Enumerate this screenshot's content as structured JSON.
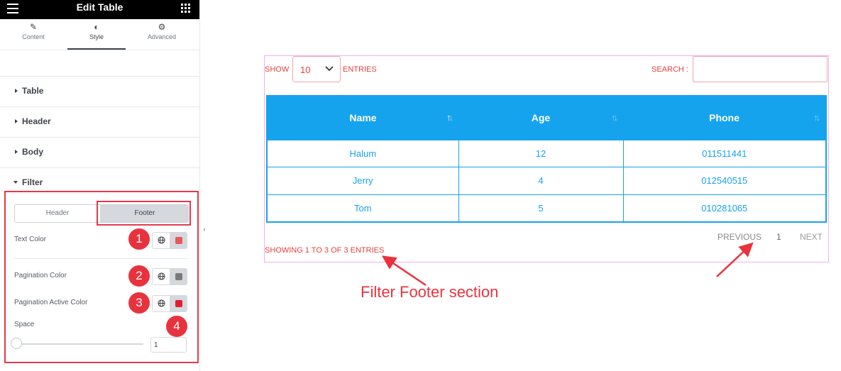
{
  "panel": {
    "title": "Edit Table",
    "tabs": [
      {
        "label": "Content",
        "icon": "pencil-icon"
      },
      {
        "label": "Style",
        "icon": "half-circle-icon"
      },
      {
        "label": "Advanced",
        "icon": "gear-icon"
      }
    ],
    "sections": [
      "Table",
      "Header",
      "Body",
      "Filter"
    ],
    "filter": {
      "segments": [
        "Header",
        "Footer"
      ],
      "active_segment": "Footer",
      "controls": [
        {
          "label": "Text Color",
          "color": "#e85a5a",
          "badge": "1"
        },
        {
          "label": "Pagination Color",
          "color": "#7a7a7a",
          "badge": "2"
        },
        {
          "label": "Pagination Active Color",
          "color": "#e01f2e",
          "badge": "3"
        }
      ],
      "space": {
        "label": "Space",
        "badge": "4",
        "value": "1"
      }
    }
  },
  "preview": {
    "show_label": "SHOW",
    "entries_value": "10",
    "entries_label": "ENTRIES",
    "search_label": "SEARCH :",
    "search_value": "",
    "columns": [
      "Name",
      "Age",
      "Phone"
    ],
    "rows": [
      [
        "Halum",
        "12",
        "011511441"
      ],
      [
        "Jerry",
        "4",
        "012540515"
      ],
      [
        "Tom",
        "5",
        "010281065"
      ]
    ],
    "info": "SHOWING 1 TO 3 OF 3 ENTRIES",
    "pagination": {
      "previous": "PREVIOUS",
      "current": "1",
      "next": "NEXT"
    }
  },
  "annotation": {
    "callout": "Filter Footer section"
  },
  "colors": {
    "accent": "#16a3ee",
    "highlight": "#e43a4a",
    "filter_text": "#e8413f"
  }
}
